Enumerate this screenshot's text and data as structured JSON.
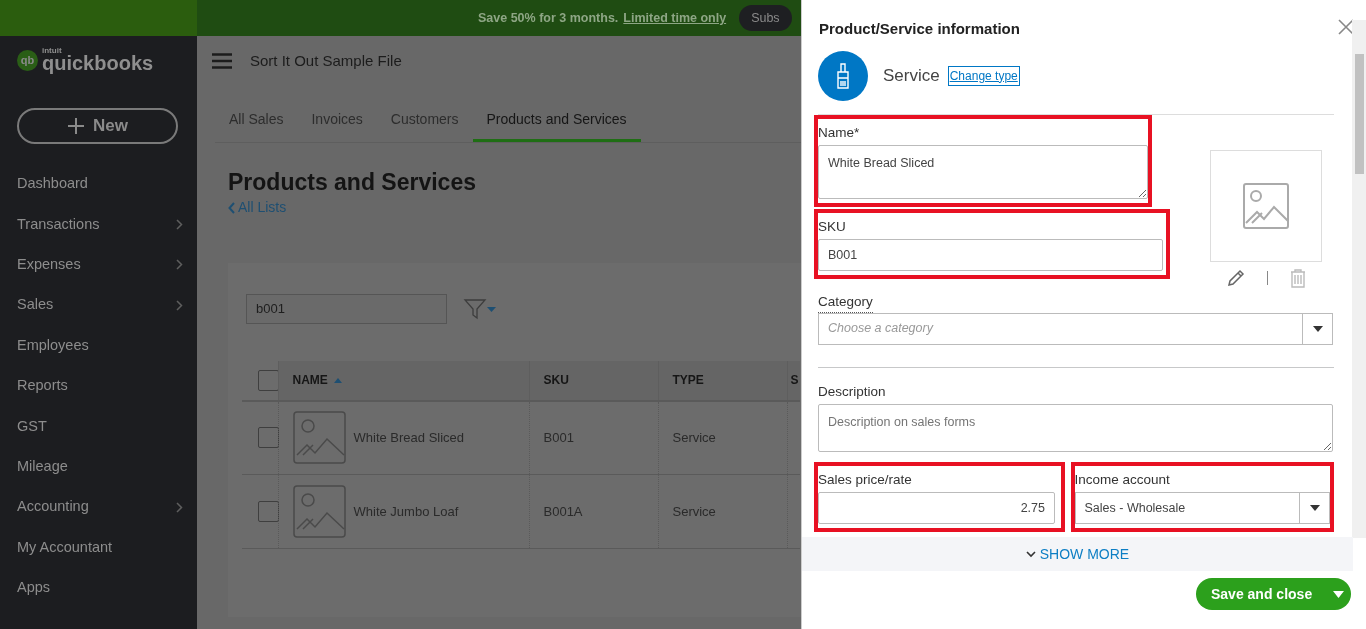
{
  "banner": {
    "text": "Save 50% for 3 months.",
    "link": "Limited time only",
    "button": "Subs"
  },
  "logo": {
    "mark": "qb",
    "small": "intuit",
    "brand": "quickbooks"
  },
  "new_button": "New",
  "sidebar": {
    "items": [
      {
        "label": "Dashboard",
        "has_submenu": false
      },
      {
        "label": "Transactions",
        "has_submenu": true
      },
      {
        "label": "Expenses",
        "has_submenu": true
      },
      {
        "label": "Sales",
        "has_submenu": true
      },
      {
        "label": "Employees",
        "has_submenu": false
      },
      {
        "label": "Reports",
        "has_submenu": false
      },
      {
        "label": "GST",
        "has_submenu": false
      },
      {
        "label": "Mileage",
        "has_submenu": false
      },
      {
        "label": "Accounting",
        "has_submenu": true
      },
      {
        "label": "My Accountant",
        "has_submenu": false
      },
      {
        "label": "Apps",
        "has_submenu": false
      }
    ]
  },
  "header": {
    "company": "Sort It Out Sample File"
  },
  "tabs": [
    {
      "label": "All Sales",
      "selected": false
    },
    {
      "label": "Invoices",
      "selected": false
    },
    {
      "label": "Customers",
      "selected": false
    },
    {
      "label": "Products and Services",
      "selected": true
    }
  ],
  "page": {
    "title": "Products and Services",
    "back_link": "All Lists"
  },
  "search": {
    "value": "b001"
  },
  "table": {
    "all_checked": false,
    "columns": [
      {
        "label": "NAME",
        "sorted": true
      },
      {
        "label": "SKU",
        "sorted": false
      },
      {
        "label": "TYPE",
        "sorted": false
      },
      {
        "label": "S",
        "sorted": false
      }
    ],
    "rows": [
      {
        "name": "White Bread Sliced",
        "sku": "B001",
        "type": "Service",
        "checked": false
      },
      {
        "name": "White Jumbo Loaf",
        "sku": "B001A",
        "type": "Service",
        "checked": false
      }
    ]
  },
  "panel": {
    "title": "Product/Service information",
    "type_label": "Service",
    "change_type": "Change type",
    "name_field": {
      "label": "Name*",
      "value": "White Bread Sliced",
      "highlighted": true
    },
    "sku_field": {
      "label": "SKU",
      "value": "B001",
      "highlighted": true
    },
    "category_field": {
      "label": "Category",
      "placeholder": "Choose a category",
      "highlighted": false
    },
    "description_field": {
      "label": "Description",
      "placeholder": "Description on sales forms",
      "highlighted": false
    },
    "price_field": {
      "label": "Sales price/rate",
      "value": "2.75",
      "highlighted": true
    },
    "income_field": {
      "label": "Income account",
      "value": "Sales - Wholesale",
      "highlighted": true
    },
    "show_more": "SHOW MORE",
    "save_button": "Save and close"
  }
}
